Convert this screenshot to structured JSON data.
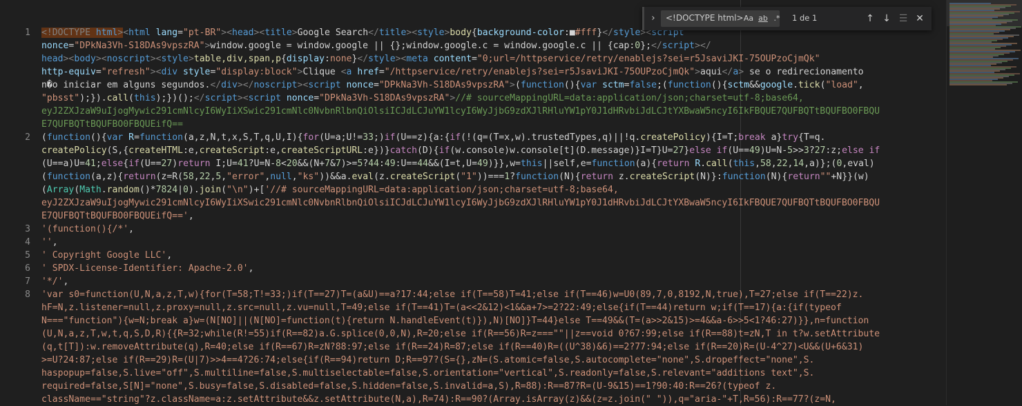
{
  "editor": {
    "line_numbers": [
      "1",
      "2",
      "3",
      "4",
      "5",
      "6",
      "7",
      "8"
    ],
    "lines": [
      [
        [
          "dg hl",
          "<!DOCTYPE "
        ],
        [
          "tg hl",
          "html"
        ],
        [
          "dg hl",
          ">"
        ],
        [
          "dg",
          "<"
        ],
        [
          "tg",
          "html "
        ],
        [
          "at",
          "lang"
        ],
        [
          "pu",
          "="
        ],
        [
          "st",
          "\"pt-BR\""
        ],
        [
          "dg",
          "><"
        ],
        [
          "tg",
          "head"
        ],
        [
          "dg",
          "><"
        ],
        [
          "tg",
          "title"
        ],
        [
          "dg",
          ">"
        ],
        [
          "pu",
          "Google Search"
        ],
        [
          "dg",
          "</"
        ],
        [
          "tg",
          "title"
        ],
        [
          "dg",
          "><"
        ],
        [
          "tg",
          "style"
        ],
        [
          "dg",
          ">"
        ],
        [
          "fn",
          "body"
        ],
        [
          "pu",
          "{"
        ],
        [
          "at",
          "background-color"
        ],
        [
          "pu",
          ":"
        ],
        [
          "pu",
          "■"
        ],
        [
          "st",
          "#fff"
        ],
        [
          "pu",
          "}"
        ],
        [
          "dg",
          "</"
        ],
        [
          "tg",
          "style"
        ],
        [
          "dg",
          "><"
        ],
        [
          "tg",
          "script"
        ]
      ],
      [
        [
          "at",
          "nonce"
        ],
        [
          "pu",
          "="
        ],
        [
          "st",
          "\"DPkNa3Vh-S18DAs9vpszRA\""
        ],
        [
          "dg",
          ">"
        ],
        [
          "pu",
          "window.google = window.google || {};window.google.c = window.google.c || {cap:"
        ],
        [
          "nm",
          "0"
        ],
        [
          "pu",
          "};"
        ],
        [
          "dg",
          "</"
        ],
        [
          "tg",
          "script"
        ],
        [
          "dg",
          "></"
        ]
      ],
      [
        [
          "tg",
          "head"
        ],
        [
          "dg",
          "><"
        ],
        [
          "tg",
          "body"
        ],
        [
          "dg",
          "><"
        ],
        [
          "tg",
          "noscript"
        ],
        [
          "dg",
          "><"
        ],
        [
          "tg",
          "style"
        ],
        [
          "dg",
          ">"
        ],
        [
          "fn",
          "table,div,span,p"
        ],
        [
          "pu",
          "{"
        ],
        [
          "at",
          "display"
        ],
        [
          "pu",
          ":"
        ],
        [
          "st",
          "none"
        ],
        [
          "pu",
          "}"
        ],
        [
          "dg",
          "</"
        ],
        [
          "tg",
          "style"
        ],
        [
          "dg",
          "><"
        ],
        [
          "tg",
          "meta "
        ],
        [
          "at",
          "content"
        ],
        [
          "pu",
          "="
        ],
        [
          "st",
          "\"0;url=/httpservice/retry/enablejs?sei=r5JsaviJKI-75OUPzoCjmQk\""
        ]
      ],
      [
        [
          "at",
          "http-equiv"
        ],
        [
          "pu",
          "="
        ],
        [
          "st",
          "\"refresh\""
        ],
        [
          "dg",
          "><"
        ],
        [
          "tg",
          "div "
        ],
        [
          "at",
          "style"
        ],
        [
          "pu",
          "="
        ],
        [
          "st",
          "\"display:block\""
        ],
        [
          "dg",
          ">"
        ],
        [
          "pu",
          "Clique "
        ],
        [
          "dg",
          "<"
        ],
        [
          "tg",
          "a "
        ],
        [
          "at",
          "href"
        ],
        [
          "pu",
          "="
        ],
        [
          "st",
          "\"/httpservice/retry/enablejs?sei=r5JsaviJKI-75OUPzoCjmQk\""
        ],
        [
          "dg",
          ">"
        ],
        [
          "pu",
          "aqui"
        ],
        [
          "dg",
          "</"
        ],
        [
          "tg",
          "a"
        ],
        [
          "dg",
          ">"
        ],
        [
          "pu",
          " se o redirecionamento"
        ]
      ],
      [
        [
          "pu",
          "n�o iniciar em alguns segundos."
        ],
        [
          "dg",
          "</"
        ],
        [
          "tg",
          "div"
        ],
        [
          "dg",
          "></"
        ],
        [
          "tg",
          "noscript"
        ],
        [
          "dg",
          "><"
        ],
        [
          "tg",
          "script "
        ],
        [
          "at",
          "nonce"
        ],
        [
          "pu",
          "="
        ],
        [
          "st",
          "\"DPkNa3Vh-S18DAs9vpszRA\""
        ],
        [
          "dg",
          ">"
        ],
        [
          "pu",
          "("
        ],
        [
          "kw",
          "function"
        ],
        [
          "pu",
          "(){"
        ],
        [
          "kw",
          "var "
        ],
        [
          "vr",
          "sctm"
        ],
        [
          "pu",
          "="
        ],
        [
          "kw",
          "false"
        ],
        [
          "pu",
          ";("
        ],
        [
          "kw",
          "function"
        ],
        [
          "pu",
          "(){"
        ],
        [
          "vr",
          "sctm"
        ],
        [
          "pu",
          "&&"
        ],
        [
          "vr",
          "google"
        ],
        [
          "pu",
          "."
        ],
        [
          "fn",
          "tick"
        ],
        [
          "pu",
          "("
        ],
        [
          "st",
          "\"load\""
        ],
        [
          "pu",
          ","
        ]
      ],
      [
        [
          "st",
          "\"pbsst\""
        ],
        [
          "pu",
          ");})."
        ],
        [
          "fn",
          "call"
        ],
        [
          "pu",
          "("
        ],
        [
          "kw",
          "this"
        ],
        [
          "pu",
          ");})();"
        ],
        [
          "dg",
          "</"
        ],
        [
          "tg",
          "script"
        ],
        [
          "dg",
          "><"
        ],
        [
          "tg",
          "script "
        ],
        [
          "at",
          "nonce"
        ],
        [
          "pu",
          "="
        ],
        [
          "st",
          "\"DPkNa3Vh-S18DAs9vpszRA\""
        ],
        [
          "dg",
          ">"
        ],
        [
          "cm",
          "//# sourceMappingURL=data:application/json;charset=utf-8;base64,"
        ]
      ],
      [
        [
          "cm",
          "eyJ2ZXJzaW9uIjogMywic291cmNlcyI6WyIiXSwic291cmNlc0NvbnRlbnQiOlsiICJdLCJuYW1lcyI6WyJjbG9zdXJlRHluYW1pY0J1dHRvbiJdLCJtYXBwaW5ncyI6IkFBQUE7QUFBQTtBQUFBO0FBQU"
        ]
      ],
      [
        [
          "cm",
          "E7QUFBQTtBQUFBO0FBQUEifQ=="
        ]
      ],
      [
        [
          "pu",
          "("
        ],
        [
          "kw",
          "function"
        ],
        [
          "pu",
          "(){"
        ],
        [
          "kw",
          "var "
        ],
        [
          "vr",
          "R"
        ],
        [
          "pu",
          "="
        ],
        [
          "kw",
          "function"
        ],
        [
          "pu",
          "(a,z,N,t,x,S,T,q,U,I){"
        ],
        [
          "ct",
          "for"
        ],
        [
          "pu",
          "(U=a;U!="
        ],
        [
          "nm",
          "33"
        ],
        [
          "pu",
          ";)"
        ],
        [
          "ct",
          "if"
        ],
        [
          "pu",
          "(U==z){a:{"
        ],
        [
          "ct",
          "if"
        ],
        [
          "pu",
          "(!(q=(T=x,w).trustedTypes,q)||!q."
        ],
        [
          "fn",
          "createPolicy"
        ],
        [
          "pu",
          "){I=T;"
        ],
        [
          "ct",
          "break "
        ],
        [
          "pu",
          "a}"
        ],
        [
          "ct",
          "try"
        ],
        [
          "pu",
          "{T=q."
        ]
      ],
      [
        [
          "fn",
          "createPolicy"
        ],
        [
          "pu",
          "(S,{"
        ],
        [
          "fn",
          "createHTML"
        ],
        [
          "pu",
          ":e,"
        ],
        [
          "fn",
          "createScript"
        ],
        [
          "pu",
          ":e,"
        ],
        [
          "fn",
          "createScriptURL"
        ],
        [
          "pu",
          ":e})}"
        ],
        [
          "ct",
          "catch"
        ],
        [
          "pu",
          "(D){"
        ],
        [
          "ct",
          "if"
        ],
        [
          "pu",
          "(w.console)w.console[t](D.message)}I=T}U="
        ],
        [
          "nm",
          "27"
        ],
        [
          "pu",
          "}"
        ],
        [
          "ct",
          "else if"
        ],
        [
          "pu",
          "(U=="
        ],
        [
          "nm",
          "49"
        ],
        [
          "pu",
          ")U=N-"
        ],
        [
          "nm",
          "5"
        ],
        [
          "pu",
          ">>"
        ],
        [
          "nm",
          "3"
        ],
        [
          "pu",
          "?"
        ],
        [
          "nm",
          "27"
        ],
        [
          "pu",
          ":z;"
        ],
        [
          "ct",
          "else if"
        ]
      ],
      [
        [
          "pu",
          "(U==a)U="
        ],
        [
          "nm",
          "41"
        ],
        [
          "pu",
          ";"
        ],
        [
          "ct",
          "else"
        ],
        [
          "pu",
          "{"
        ],
        [
          "ct",
          "if"
        ],
        [
          "pu",
          "(U=="
        ],
        [
          "nm",
          "27"
        ],
        [
          "pu",
          ")"
        ],
        [
          "ct",
          "return "
        ],
        [
          "pu",
          "I;U="
        ],
        [
          "nm",
          "41"
        ],
        [
          "pu",
          "?U=N-"
        ],
        [
          "nm",
          "8"
        ],
        [
          "pu",
          "<"
        ],
        [
          "nm",
          "20"
        ],
        [
          "pu",
          "&&(N+"
        ],
        [
          "nm",
          "7"
        ],
        [
          "pu",
          "&"
        ],
        [
          "nm",
          "7"
        ],
        [
          "pu",
          ")>="
        ],
        [
          "nm",
          "5"
        ],
        [
          "pu",
          "?"
        ],
        [
          "nm",
          "44"
        ],
        [
          "pu",
          ":"
        ],
        [
          "nm",
          "49"
        ],
        [
          "pu",
          ":U=="
        ],
        [
          "nm",
          "44"
        ],
        [
          "pu",
          "&&(I=t,U="
        ],
        [
          "nm",
          "49"
        ],
        [
          "pu",
          ")}},w="
        ],
        [
          "kw",
          "this"
        ],
        [
          "pu",
          "||self,e="
        ],
        [
          "kw",
          "function"
        ],
        [
          "pu",
          "(a){"
        ],
        [
          "ct",
          "return "
        ],
        [
          "vr",
          "R"
        ],
        [
          "pu",
          "."
        ],
        [
          "fn",
          "call"
        ],
        [
          "pu",
          "("
        ],
        [
          "kw",
          "this"
        ],
        [
          "pu",
          ","
        ],
        [
          "nm",
          "58"
        ],
        [
          "pu",
          ","
        ],
        [
          "nm",
          "22"
        ],
        [
          "pu",
          ","
        ],
        [
          "nm",
          "14"
        ],
        [
          "pu",
          ",a)};("
        ],
        [
          "nm",
          "0"
        ],
        [
          "pu",
          ",eval)"
        ]
      ],
      [
        [
          "pu",
          "("
        ],
        [
          "kw",
          "function"
        ],
        [
          "pu",
          "(a,z){"
        ],
        [
          "ct",
          "return"
        ],
        [
          "pu",
          "(z=R("
        ],
        [
          "nm",
          "58"
        ],
        [
          "pu",
          ","
        ],
        [
          "nm",
          "22"
        ],
        [
          "pu",
          ","
        ],
        [
          "nm",
          "5"
        ],
        [
          "pu",
          ","
        ],
        [
          "st",
          "\"error\""
        ],
        [
          "pu",
          ","
        ],
        [
          "kw",
          "null"
        ],
        [
          "pu",
          ","
        ],
        [
          "st",
          "\"ks\""
        ],
        [
          "pu",
          "))&&a."
        ],
        [
          "fn",
          "eval"
        ],
        [
          "pu",
          "(z."
        ],
        [
          "fn",
          "createScript"
        ],
        [
          "pu",
          "("
        ],
        [
          "st",
          "\"1\""
        ],
        [
          "pu",
          "))==="
        ],
        [
          "nm",
          "1"
        ],
        [
          "pu",
          "?"
        ],
        [
          "kw",
          "function"
        ],
        [
          "pu",
          "(N){"
        ],
        [
          "ct",
          "return "
        ],
        [
          "pu",
          "z."
        ],
        [
          "fn",
          "createScript"
        ],
        [
          "pu",
          "(N)}:"
        ],
        [
          "kw",
          "function"
        ],
        [
          "pu",
          "(N){"
        ],
        [
          "ct",
          "return"
        ],
        [
          "st",
          "\"\""
        ],
        [
          "pu",
          "+N}}(w)"
        ]
      ],
      [
        [
          "pu",
          "("
        ],
        [
          "ty",
          "Array"
        ],
        [
          "pu",
          "("
        ],
        [
          "ty",
          "Math"
        ],
        [
          "pu",
          "."
        ],
        [
          "fn",
          "random"
        ],
        [
          "pu",
          "()*"
        ],
        [
          "nm",
          "7824"
        ],
        [
          "pu",
          "|"
        ],
        [
          "nm",
          "0"
        ],
        [
          "pu",
          ")."
        ],
        [
          "fn",
          "join"
        ],
        [
          "pu",
          "("
        ],
        [
          "st",
          "\"\\n\""
        ],
        [
          "pu",
          ")+["
        ],
        [
          "st",
          "'//# sourceMappingURL=data:application/json;charset=utf-8;base64,"
        ]
      ],
      [
        [
          "st",
          "eyJ2ZXJzaW9uIjogMywic291cmNlcyI6WyIiXSwic291cmNlc0NvbnRlbnQiOlsiICJdLCJuYW1lcyI6WyJjbG9zdXJlRHluYW1pY0J1dHRvbiJdLCJtYXBwaW5ncyI6IkFBQUE7QUFBQTtBQUFBO0FBQU"
        ]
      ],
      [
        [
          "st",
          "E7QUFBQTtBQUFBO0FBQUEifQ=='"
        ],
        [
          "pu",
          ","
        ]
      ],
      [
        [
          "st",
          "'(function(){/*'"
        ],
        [
          "pu",
          ","
        ]
      ],
      [
        [
          "st",
          "''"
        ],
        [
          "pu",
          ","
        ]
      ],
      [
        [
          "st",
          "' Copyright Google LLC'"
        ],
        [
          "pu",
          ","
        ]
      ],
      [
        [
          "st",
          "' SPDX-License-Identifier: Apache-2.0'"
        ],
        [
          "pu",
          ","
        ]
      ],
      [
        [
          "st",
          "'*/'"
        ],
        [
          "pu",
          ","
        ]
      ],
      [
        [
          "st",
          "'var s0=function(U,N,a,z,T,w){for(T=58;T!=33;)if(T==27)T=(a&U)==a?17:44;else if(T==58)T=41;else if(T==46)w=U0(89,7,0,8192,N,true),T=27;else if(T==22)z."
        ]
      ],
      [
        [
          "st",
          "hF=N,z.listener=null,z.proxy=null,z.src=null,z.vu=null,T=49;else if(T==41)T=(a<<2&12)<1&&a+7>=2?22:49;else{if(T==44)return w;if(T==17){a:{if(typeof"
        ]
      ],
      [
        [
          "st",
          "N===\"function\"){w=N;break a}w=(N[NO]||(N[NO]=function(t){return N.handleEvent(t)}),N)[NO]}T=44}else T==49&&(T=(a>>2&15)>=4&&a-6>>5<1?46:27)}},n=function"
        ]
      ],
      [
        [
          "st",
          "(U,N,a,z,T,w,t,q,S,D,R){{R=32;while(R!=55)if(R==82)a.G.splice(0,0,N),R=20;else if(R==56)R=z===\"\"||z==void 0?67:99;else if(R==88)t=zN,T in t?w.setAttribute"
        ]
      ],
      [
        [
          "st",
          "(q,t[T]):w.removeAttribute(q),R=40;else if(R==67)R=zN?88:97;else if(R==24)R=87;else if(R==40)R=((U^38)&6)==2?77:94;else if(R==20)R=(U-4^27)<U&&(U+6&31)"
        ]
      ],
      [
        [
          "st",
          ">=U?24:87;else if(R==29)R=(U|7)>>4==4?26:74;else{if(R==94)return D;R==97?(S={},zN=(S.atomic=false,S.autocomplete=\"none\",S.dropeffect=\"none\",S."
        ]
      ],
      [
        [
          "st",
          "haspopup=false,S.live=\"off\",S.multiline=false,S.multiselectable=false,S.orientation=\"vertical\",S.readonly=false,S.relevant=\"additions text\",S."
        ]
      ],
      [
        [
          "st",
          "required=false,S[N]=\"none\",S.busy=false,S.disabled=false,S.hidden=false,S.invalid=a,S),R=88):R==87?R=(U-9&15)==1?90:40:R==26?(typeof z."
        ]
      ],
      [
        [
          "st",
          "className==\"string\"?z.className=a:z.setAttribute&&z.setAttribute(N,a),R=74):R==90?(Array.isArray(z)&&(z=z.join(\" \")),q=\"aria-\"+T,R=56):R==77?(z=N,"
        ]
      ]
    ]
  },
  "find_widget": {
    "toggle_icon": "chevron-right-icon",
    "query": "<!DOCTYPE html>",
    "match_case": "Aa",
    "whole_word": "ab",
    "regex": ".*",
    "result_count": "1 de 1",
    "prev_icon": "arrow-up-icon",
    "next_icon": "arrow-down-icon",
    "selection_icon": "find-in-selection-icon",
    "close_icon": "close-icon"
  },
  "colors": {
    "background": "#1f1f1f",
    "match_highlight": "#623315"
  }
}
